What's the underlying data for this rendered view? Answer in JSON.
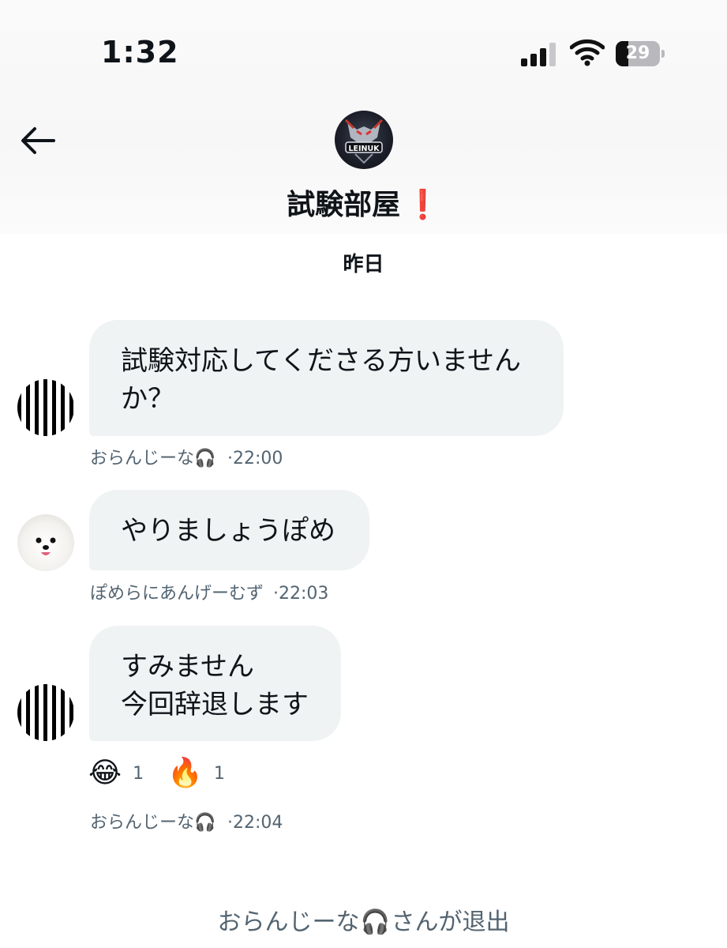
{
  "status_bar": {
    "time": "1:32",
    "battery": "29"
  },
  "header": {
    "group_name": "試験部屋",
    "title_emoji": "❗",
    "avatar_text": "LEINUK"
  },
  "date_separator": "昨日",
  "messages": [
    {
      "lines": [
        "試験対応してくださる方いません",
        "か？"
      ],
      "sender": "おらんじーな",
      "time": "·22:00"
    },
    {
      "lines": [
        "やりましょうぽめ"
      ],
      "sender": "ぽめらにあんげーむず",
      "time": "·22:03"
    },
    {
      "lines": [
        "すみません",
        "今回辞退します"
      ],
      "sender": "おらんじーな",
      "time": "·22:04",
      "reactions": [
        {
          "emoji": "😂",
          "count": "1"
        },
        {
          "emoji": "🔥",
          "count": "1"
        }
      ]
    }
  ],
  "system_message": {
    "name": "おらんじーな",
    "text": "さんが退出"
  },
  "icons": {
    "headphones": "headphones-icon",
    "back": "back-arrow-icon"
  }
}
